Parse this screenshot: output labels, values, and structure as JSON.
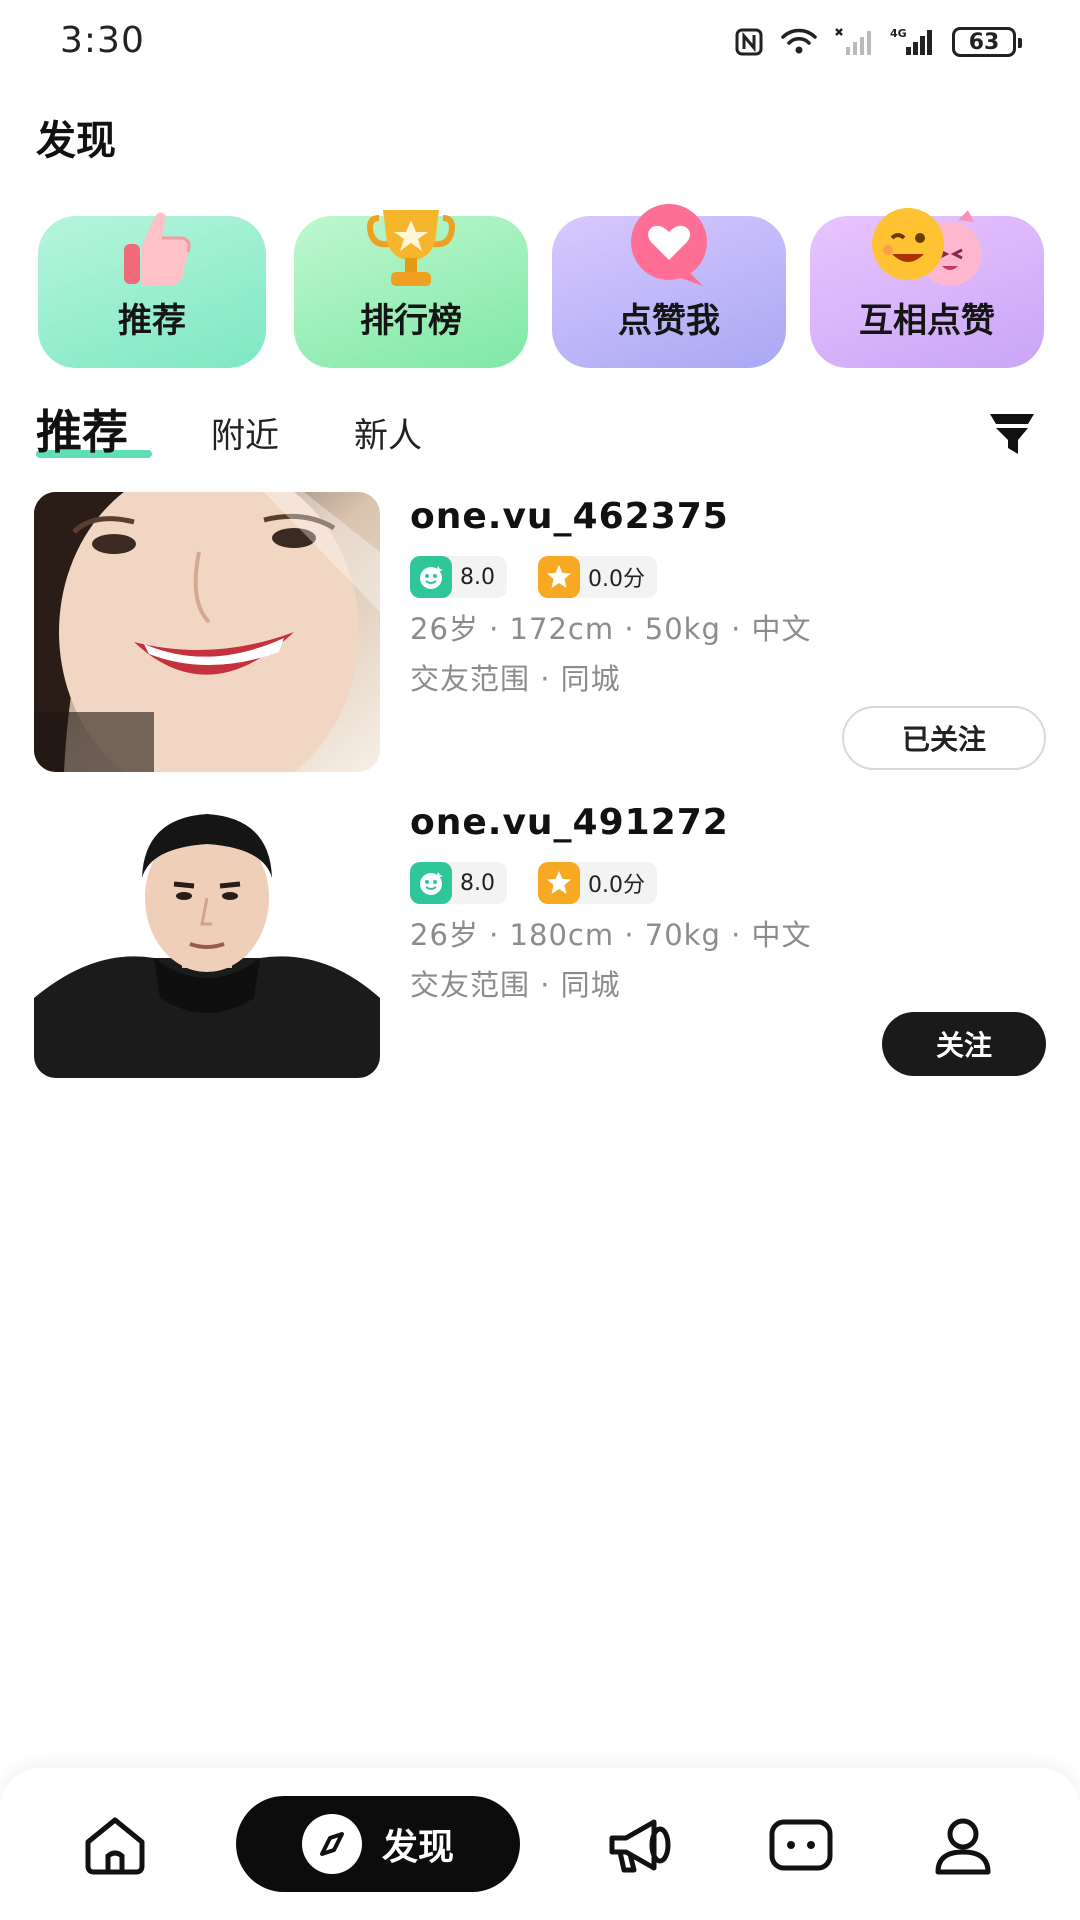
{
  "status_bar": {
    "time": "3:30",
    "battery": "63",
    "icons": [
      "nfc-icon",
      "wifi-icon",
      "no-signal-icon",
      "4g-signal-icon",
      "battery-icon"
    ]
  },
  "header": {
    "title": "发现"
  },
  "categories": [
    {
      "label": "推荐",
      "icon": "thumbs-up-icon"
    },
    {
      "label": "排行榜",
      "icon": "trophy-icon"
    },
    {
      "label": "点赞我",
      "icon": "heart-bubble-icon"
    },
    {
      "label": "互相点赞",
      "icon": "emoji-faces-icon"
    }
  ],
  "tabs": [
    {
      "label": "推荐",
      "active": true
    },
    {
      "label": "附近",
      "active": false
    },
    {
      "label": "新人",
      "active": false
    }
  ],
  "filter": {
    "icon": "filter-icon"
  },
  "users": [
    {
      "username": "one.vu_462375",
      "badge_a": "8.0",
      "badge_b": "0.0分",
      "info": "26岁 · 172cm · 50kg · 中文",
      "range": "交友范围 · 同城",
      "follow_label": "已关注",
      "followed": true
    },
    {
      "username": "one.vu_491272",
      "badge_a": "8.0",
      "badge_b": "0.0分",
      "info": "26岁 · 180cm · 70kg · 中文",
      "range": "交友范围 · 同城",
      "follow_label": "关注",
      "followed": false
    }
  ],
  "bottom_nav": {
    "active_label": "发现",
    "items": [
      "home-icon",
      "compass-icon",
      "megaphone-icon",
      "chat-icon",
      "profile-icon"
    ]
  },
  "colors": {
    "accent": "#5fe0b4",
    "badge_green": "#2fc79a",
    "badge_orange": "#f7a924",
    "dark": "#1a1a1a"
  }
}
